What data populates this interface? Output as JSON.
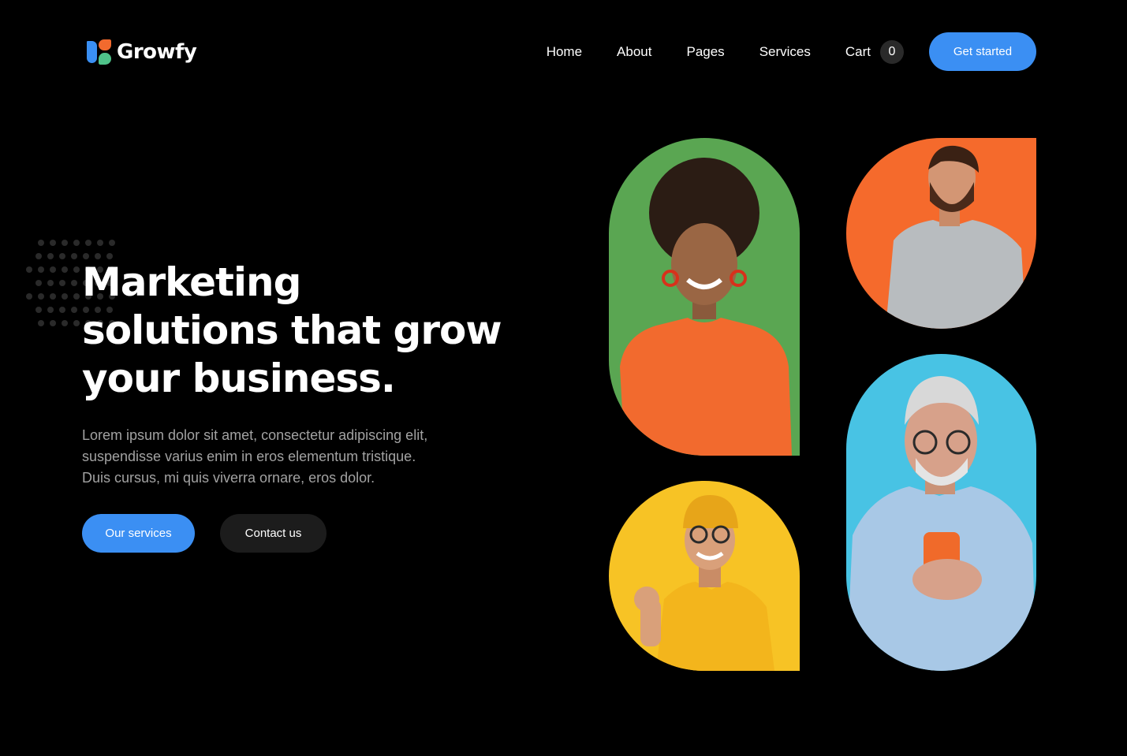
{
  "brand": {
    "name": "Growfy"
  },
  "nav": {
    "links": [
      "Home",
      "About",
      "Pages",
      "Services"
    ],
    "cart_label": "Cart",
    "cart_count": "0",
    "cta_label": "Get started"
  },
  "hero": {
    "title_lines": [
      "Marketing",
      "solutions that grow",
      "your business."
    ],
    "description_lines": [
      "Lorem ipsum dolor sit amet, consectetur adipiscing elit,",
      "suspendisse varius enim in eros elementum tristique.",
      "Duis cursus, mi quis viverra ornare, eros dolor."
    ],
    "primary_button": "Our services",
    "secondary_button": "Contact us"
  },
  "photos": [
    {
      "name": "woman-green-background",
      "background": "#5aa652",
      "shirt": "#f26a2e"
    },
    {
      "name": "bearded-man-orange-background",
      "background": "#f56a2c",
      "shirt": "#b8bcbf"
    },
    {
      "name": "man-yellow-background",
      "background": "#f7c325",
      "shirt": "#f7c325"
    },
    {
      "name": "older-man-blue-background",
      "background": "#48c3e4",
      "shirt": "#a8c8e6"
    }
  ],
  "colors": {
    "background": "#000000",
    "accent": "#3b8ff3",
    "secondary_button": "#1c1c1c",
    "body_text": "#a2a2a2",
    "logo": [
      "#3a8ff3",
      "#f26a2e",
      "#4fc38a"
    ]
  }
}
